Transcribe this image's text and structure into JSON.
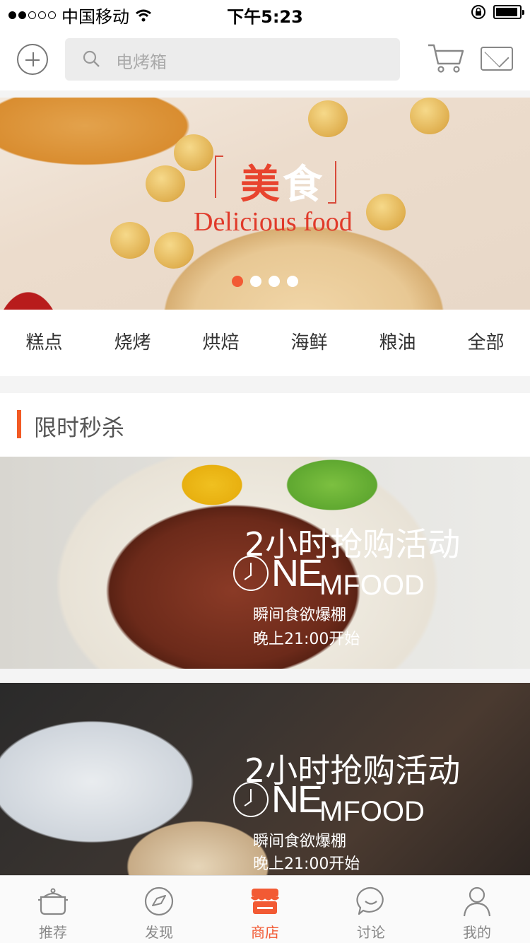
{
  "status_bar": {
    "carrier": "中国移动",
    "time": "下午5:23"
  },
  "header": {
    "search_placeholder": "电烤箱"
  },
  "banner": {
    "title_part1": "美",
    "title_part2": "食",
    "subtitle": "Delicious food",
    "page_count": 4,
    "active_page": 1
  },
  "categories": [
    "糕点",
    "烧烤",
    "烘焙",
    "海鲜",
    "粮油",
    "全部"
  ],
  "section": {
    "title": "限时秒杀"
  },
  "promos": [
    {
      "headline": "2小时抢购活动",
      "brand_big": "NE",
      "brand_small": "MFOOD",
      "line1": "瞬间食欲爆棚",
      "line2": "晚上21:00开始"
    },
    {
      "headline": "2小时抢购活动",
      "brand_big": "NE",
      "brand_small": "MFOOD",
      "line1": "瞬间食欲爆棚",
      "line2": "晚上21:00开始"
    }
  ],
  "tabbar": {
    "items": [
      {
        "label": "推荐",
        "icon": "pot-icon"
      },
      {
        "label": "发现",
        "icon": "compass-icon"
      },
      {
        "label": "商店",
        "icon": "store-icon"
      },
      {
        "label": "讨论",
        "icon": "chat-icon"
      },
      {
        "label": "我的",
        "icon": "user-icon"
      }
    ],
    "active_index": 2,
    "accent_color": "#f25a34"
  }
}
